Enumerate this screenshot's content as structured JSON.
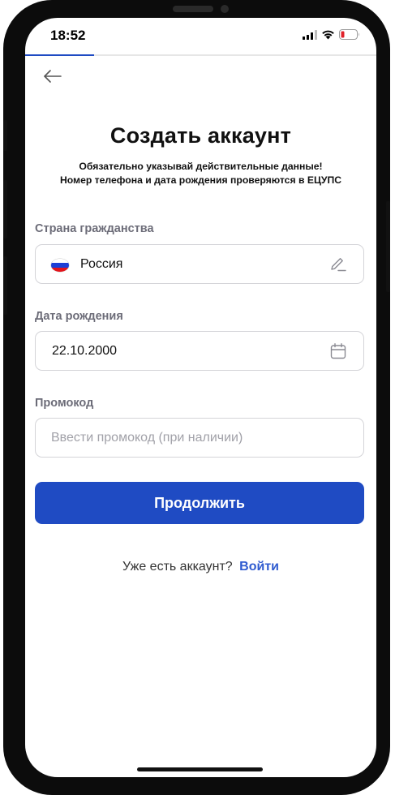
{
  "status_bar": {
    "time": "18:52",
    "icons": [
      "cellular-signal-icon",
      "wifi-icon",
      "battery-low-icon"
    ]
  },
  "header": {
    "back_icon": "arrow-left-icon"
  },
  "page": {
    "title": "Создать аккаунт",
    "subtitle_line1": "Обязательно указывай действительные данные!",
    "subtitle_line2": "Номер телефона и дата рождения проверяются в ЕЦУПС"
  },
  "form": {
    "country": {
      "label": "Страна гражданства",
      "value": "Россия",
      "flag_colors": [
        "#ffffff",
        "#1c3fd6",
        "#e3141b"
      ],
      "icon": "pencil-edit-icon"
    },
    "birthdate": {
      "label": "Дата рождения",
      "value": "22.10.2000",
      "icon": "calendar-icon"
    },
    "promo": {
      "label": "Промокод",
      "value": "",
      "placeholder": "Ввести промокод (при наличии)"
    },
    "continue_label": "Продолжить"
  },
  "footer": {
    "have_account": "Уже есть аккаунт?",
    "login_label": "Войти"
  },
  "colors": {
    "primary": "#1f4bc3",
    "link": "#2f5bd0",
    "label": "#6c6c78"
  }
}
